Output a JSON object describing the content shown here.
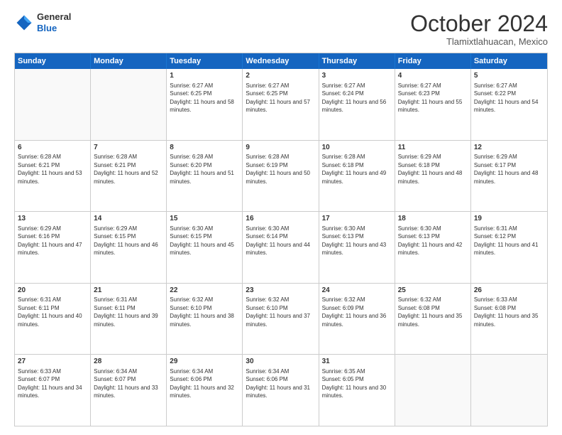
{
  "logo": {
    "general": "General",
    "blue": "Blue"
  },
  "title": "October 2024",
  "location": "Tlamixtlahuacan, Mexico",
  "days": [
    "Sunday",
    "Monday",
    "Tuesday",
    "Wednesday",
    "Thursday",
    "Friday",
    "Saturday"
  ],
  "weeks": [
    [
      {
        "day": "",
        "empty": true
      },
      {
        "day": "",
        "empty": true
      },
      {
        "day": "1",
        "sunrise": "Sunrise: 6:27 AM",
        "sunset": "Sunset: 6:25 PM",
        "daylight": "Daylight: 11 hours and 58 minutes."
      },
      {
        "day": "2",
        "sunrise": "Sunrise: 6:27 AM",
        "sunset": "Sunset: 6:25 PM",
        "daylight": "Daylight: 11 hours and 57 minutes."
      },
      {
        "day": "3",
        "sunrise": "Sunrise: 6:27 AM",
        "sunset": "Sunset: 6:24 PM",
        "daylight": "Daylight: 11 hours and 56 minutes."
      },
      {
        "day": "4",
        "sunrise": "Sunrise: 6:27 AM",
        "sunset": "Sunset: 6:23 PM",
        "daylight": "Daylight: 11 hours and 55 minutes."
      },
      {
        "day": "5",
        "sunrise": "Sunrise: 6:27 AM",
        "sunset": "Sunset: 6:22 PM",
        "daylight": "Daylight: 11 hours and 54 minutes."
      }
    ],
    [
      {
        "day": "6",
        "sunrise": "Sunrise: 6:28 AM",
        "sunset": "Sunset: 6:21 PM",
        "daylight": "Daylight: 11 hours and 53 minutes."
      },
      {
        "day": "7",
        "sunrise": "Sunrise: 6:28 AM",
        "sunset": "Sunset: 6:21 PM",
        "daylight": "Daylight: 11 hours and 52 minutes."
      },
      {
        "day": "8",
        "sunrise": "Sunrise: 6:28 AM",
        "sunset": "Sunset: 6:20 PM",
        "daylight": "Daylight: 11 hours and 51 minutes."
      },
      {
        "day": "9",
        "sunrise": "Sunrise: 6:28 AM",
        "sunset": "Sunset: 6:19 PM",
        "daylight": "Daylight: 11 hours and 50 minutes."
      },
      {
        "day": "10",
        "sunrise": "Sunrise: 6:28 AM",
        "sunset": "Sunset: 6:18 PM",
        "daylight": "Daylight: 11 hours and 49 minutes."
      },
      {
        "day": "11",
        "sunrise": "Sunrise: 6:29 AM",
        "sunset": "Sunset: 6:18 PM",
        "daylight": "Daylight: 11 hours and 48 minutes."
      },
      {
        "day": "12",
        "sunrise": "Sunrise: 6:29 AM",
        "sunset": "Sunset: 6:17 PM",
        "daylight": "Daylight: 11 hours and 48 minutes."
      }
    ],
    [
      {
        "day": "13",
        "sunrise": "Sunrise: 6:29 AM",
        "sunset": "Sunset: 6:16 PM",
        "daylight": "Daylight: 11 hours and 47 minutes."
      },
      {
        "day": "14",
        "sunrise": "Sunrise: 6:29 AM",
        "sunset": "Sunset: 6:15 PM",
        "daylight": "Daylight: 11 hours and 46 minutes."
      },
      {
        "day": "15",
        "sunrise": "Sunrise: 6:30 AM",
        "sunset": "Sunset: 6:15 PM",
        "daylight": "Daylight: 11 hours and 45 minutes."
      },
      {
        "day": "16",
        "sunrise": "Sunrise: 6:30 AM",
        "sunset": "Sunset: 6:14 PM",
        "daylight": "Daylight: 11 hours and 44 minutes."
      },
      {
        "day": "17",
        "sunrise": "Sunrise: 6:30 AM",
        "sunset": "Sunset: 6:13 PM",
        "daylight": "Daylight: 11 hours and 43 minutes."
      },
      {
        "day": "18",
        "sunrise": "Sunrise: 6:30 AM",
        "sunset": "Sunset: 6:13 PM",
        "daylight": "Daylight: 11 hours and 42 minutes."
      },
      {
        "day": "19",
        "sunrise": "Sunrise: 6:31 AM",
        "sunset": "Sunset: 6:12 PM",
        "daylight": "Daylight: 11 hours and 41 minutes."
      }
    ],
    [
      {
        "day": "20",
        "sunrise": "Sunrise: 6:31 AM",
        "sunset": "Sunset: 6:11 PM",
        "daylight": "Daylight: 11 hours and 40 minutes."
      },
      {
        "day": "21",
        "sunrise": "Sunrise: 6:31 AM",
        "sunset": "Sunset: 6:11 PM",
        "daylight": "Daylight: 11 hours and 39 minutes."
      },
      {
        "day": "22",
        "sunrise": "Sunrise: 6:32 AM",
        "sunset": "Sunset: 6:10 PM",
        "daylight": "Daylight: 11 hours and 38 minutes."
      },
      {
        "day": "23",
        "sunrise": "Sunrise: 6:32 AM",
        "sunset": "Sunset: 6:10 PM",
        "daylight": "Daylight: 11 hours and 37 minutes."
      },
      {
        "day": "24",
        "sunrise": "Sunrise: 6:32 AM",
        "sunset": "Sunset: 6:09 PM",
        "daylight": "Daylight: 11 hours and 36 minutes."
      },
      {
        "day": "25",
        "sunrise": "Sunrise: 6:32 AM",
        "sunset": "Sunset: 6:08 PM",
        "daylight": "Daylight: 11 hours and 35 minutes."
      },
      {
        "day": "26",
        "sunrise": "Sunrise: 6:33 AM",
        "sunset": "Sunset: 6:08 PM",
        "daylight": "Daylight: 11 hours and 35 minutes."
      }
    ],
    [
      {
        "day": "27",
        "sunrise": "Sunrise: 6:33 AM",
        "sunset": "Sunset: 6:07 PM",
        "daylight": "Daylight: 11 hours and 34 minutes."
      },
      {
        "day": "28",
        "sunrise": "Sunrise: 6:34 AM",
        "sunset": "Sunset: 6:07 PM",
        "daylight": "Daylight: 11 hours and 33 minutes."
      },
      {
        "day": "29",
        "sunrise": "Sunrise: 6:34 AM",
        "sunset": "Sunset: 6:06 PM",
        "daylight": "Daylight: 11 hours and 32 minutes."
      },
      {
        "day": "30",
        "sunrise": "Sunrise: 6:34 AM",
        "sunset": "Sunset: 6:06 PM",
        "daylight": "Daylight: 11 hours and 31 minutes."
      },
      {
        "day": "31",
        "sunrise": "Sunrise: 6:35 AM",
        "sunset": "Sunset: 6:05 PM",
        "daylight": "Daylight: 11 hours and 30 minutes."
      },
      {
        "day": "",
        "empty": true
      },
      {
        "day": "",
        "empty": true
      }
    ]
  ]
}
